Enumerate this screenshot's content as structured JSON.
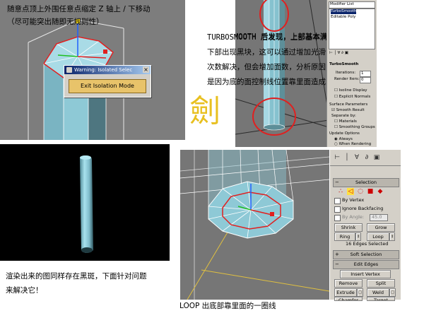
{
  "captions": {
    "top_left_line1": "随意点顶上外围任意点缩定 Z 轴上 / 下移动",
    "top_left_line2": "（尽可能突出随即无规则性）",
    "right_line1": "TURBOSMOOTH 后发现，上部基本满意",
    "right_line2": "下部出现黑块，这可以通过增加光滑",
    "right_line3": "次数解决，但会增加面数，分析原因",
    "right_line4": "是因为底的面控制线位置靠里面造成",
    "render_line1": "渲染出来的图同样存在黑斑，下面针对问题",
    "render_line2": "来解决它！",
    "loop_note": "LOOP 出底部靠里面的一圈线"
  },
  "watermark": "劍",
  "dialog": {
    "title": "Warning: Isolated Selec",
    "button": "Exit Isolation Mode"
  },
  "modifier_panel": {
    "list_label": "Modifier List",
    "stack": [
      "TurboSmooth",
      "Editable Poly"
    ],
    "section": "TurboSmooth",
    "iterations_label": "Iterations:",
    "iterations_value": "1",
    "render_iters_label": "Render Iters:",
    "render_iters_value": "0",
    "isoline": "Isoline Display",
    "explicit": "Explicit Normals",
    "surface": "Surface Parameters",
    "smooth_result": "Smooth Result",
    "separate_by": "Separate by:",
    "materials": "Materials",
    "smoothing_groups": "Smoothing Groups",
    "update": "Update Options",
    "always": "Always",
    "when_rendering": "When Rendering"
  },
  "command_panel": {
    "selection_title": "Selection",
    "by_vertex": "By Vertex",
    "ignore_backfacing": "Ignore Backfacing",
    "by_angle": "By Angle:",
    "by_angle_value": "45.0",
    "shrink": "Shrink",
    "grow": "Grow",
    "ring": "Ring",
    "loop": "Loop",
    "status": "16 Edges Selected",
    "soft_selection": "Soft Selection",
    "edit_edges": "Edit Edges",
    "insert_vertex": "Insert Vertex",
    "remove": "Remove",
    "split": "Split",
    "extrude": "Extrude",
    "weld": "Weld",
    "chamfer": "Chamfer",
    "target_weld": "Target Weld"
  },
  "colors": {
    "model": "#8ec9d6",
    "wire": "#ffffff",
    "highlight": "#e02020",
    "watermark": "#e8c020"
  }
}
